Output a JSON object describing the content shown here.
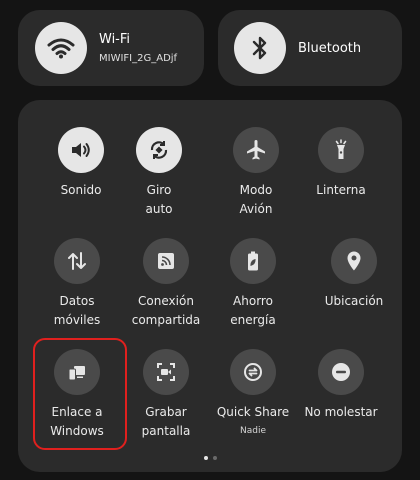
{
  "colors": {
    "background": "#141414",
    "card": "#2b2b2b",
    "tile_on": "#e6e6e6",
    "tile_off": "#4a4a4a",
    "highlight": "#e0201e"
  },
  "wifi": {
    "title": "Wi-Fi",
    "network": "MIWIFI_2G_ADjf",
    "icon": "wifi-icon"
  },
  "bluetooth": {
    "title": "Bluetooth",
    "icon": "bluetooth-icon"
  },
  "tiles": [
    {
      "label": "Sonido",
      "icon": "speaker-icon",
      "state": "on"
    },
    {
      "label": "Giro\nauto",
      "icon": "auto-rotate-icon",
      "state": "on"
    },
    {
      "label": "Modo\nAvión",
      "icon": "airplane-icon",
      "state": "off"
    },
    {
      "label": "Linterna",
      "icon": "flashlight-icon",
      "state": "off"
    },
    {
      "label": "Datos\nmóviles",
      "icon": "mobile-data-icon",
      "state": "off"
    },
    {
      "label": "Conexión\ncompartida",
      "icon": "hotspot-icon",
      "state": "off"
    },
    {
      "label": "Ahorro\nenergía",
      "icon": "battery-saver-icon",
      "state": "off"
    },
    {
      "label": "Ubicación",
      "icon": "location-icon",
      "state": "off"
    },
    {
      "label": "Enlace a\nWindows",
      "icon": "link-to-windows-icon",
      "state": "off"
    },
    {
      "label": "Grabar\npantalla",
      "icon": "screen-record-icon",
      "state": "off"
    },
    {
      "label": "Quick Share",
      "sublabel": "Nadie",
      "icon": "quick-share-icon",
      "state": "off"
    },
    {
      "label": "No molestar",
      "icon": "do-not-disturb-icon",
      "state": "off"
    }
  ],
  "pager": {
    "current_page": 1,
    "total_pages": 2
  }
}
